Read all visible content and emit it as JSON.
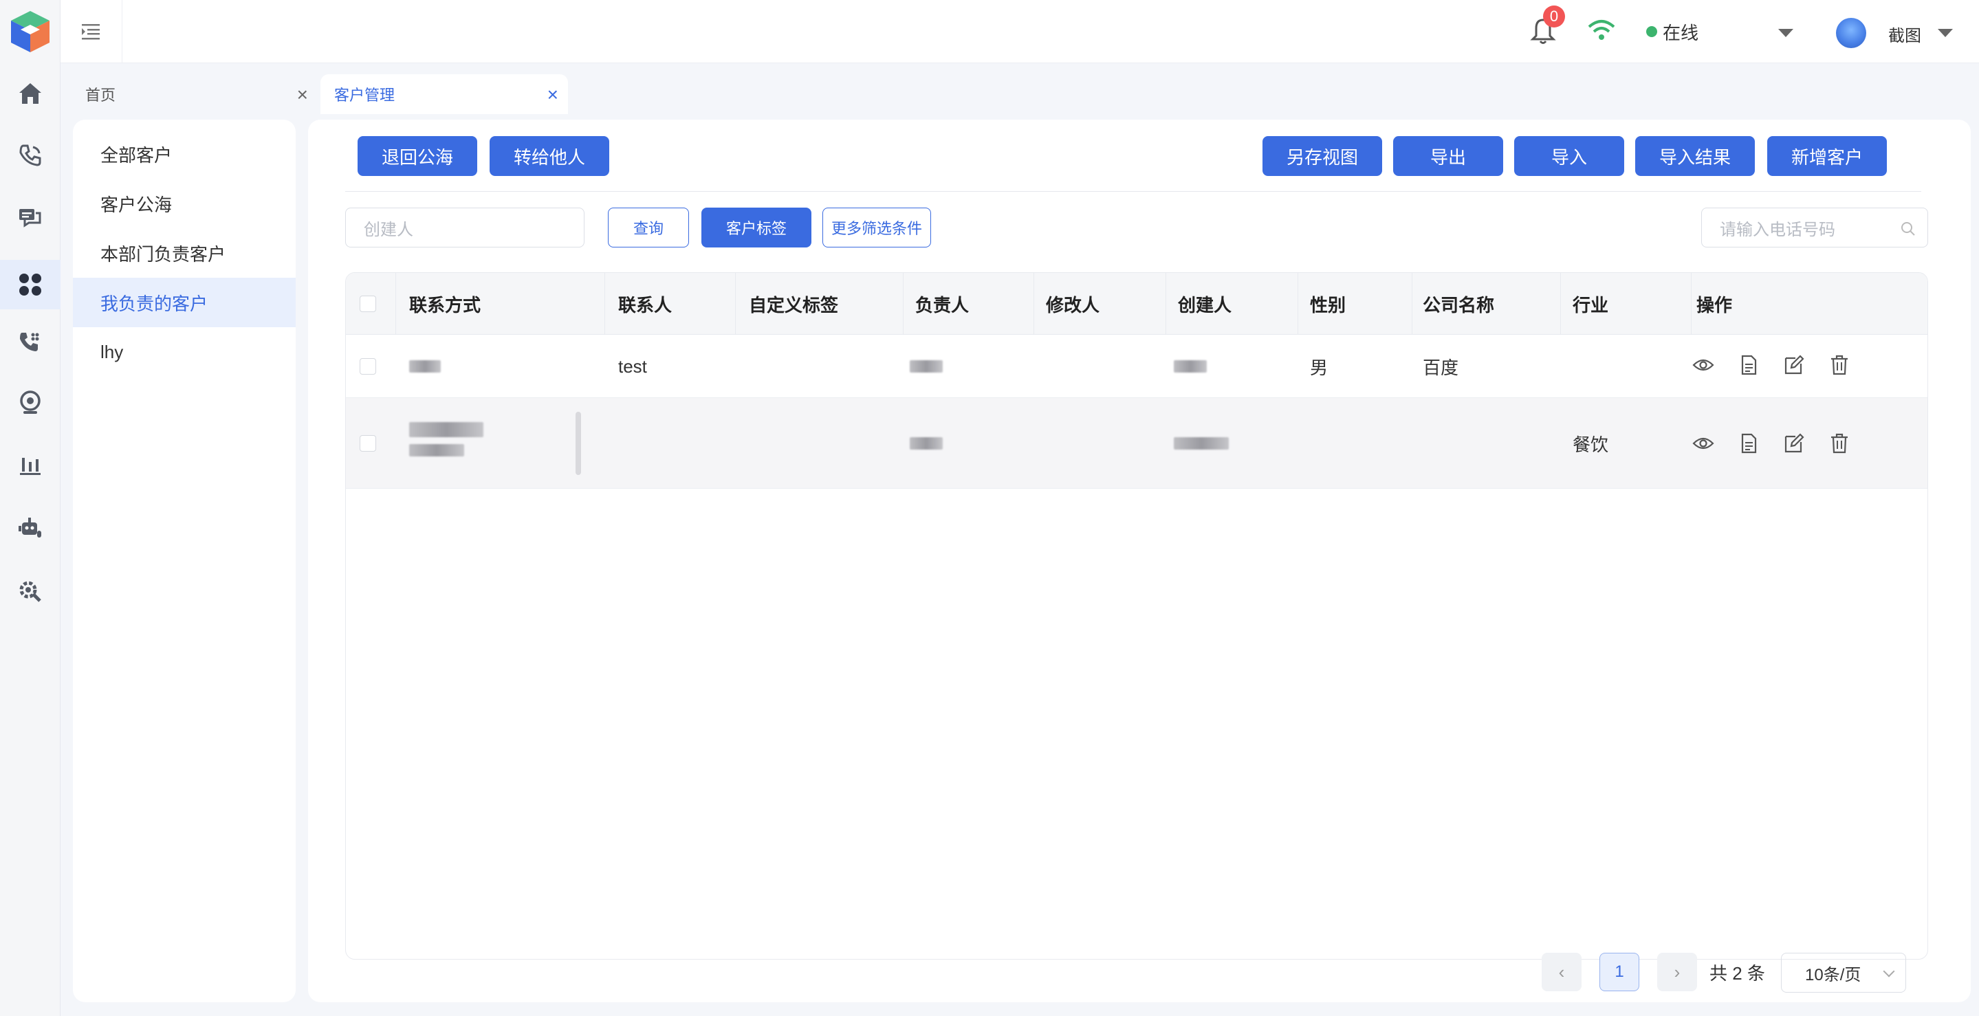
{
  "header": {
    "notification_count": "0",
    "status_label": "在线",
    "status_color": "#3cb46e",
    "user_name": "截图"
  },
  "rail_icons": [
    "home-icon",
    "phone-icon",
    "chat-icon",
    "apps-icon",
    "call-log-icon",
    "webcam-icon",
    "chart-icon",
    "robot-icon",
    "settings-icon"
  ],
  "tabs": [
    {
      "label": "首页",
      "active": false
    },
    {
      "label": "客户管理",
      "active": true
    }
  ],
  "subnav": {
    "items": [
      {
        "label": "全部客户"
      },
      {
        "label": "客户公海"
      },
      {
        "label": "本部门负责客户"
      },
      {
        "label": "我负责的客户"
      },
      {
        "label": "lhy"
      }
    ],
    "active_index": 3
  },
  "toolbar": {
    "return_pool": "退回公海",
    "transfer": "转给他人",
    "save_view": "另存视图",
    "export": "导出",
    "import": "导入",
    "import_result": "导入结果",
    "add_customer": "新增客户"
  },
  "filters": {
    "creator_placeholder": "创建人",
    "query": "查询",
    "customer_tags": "客户标签",
    "more_filters": "更多筛选条件",
    "phone_placeholder": "请输入电话号码"
  },
  "table": {
    "columns": [
      "联系方式",
      "联系人",
      "自定义标签",
      "负责人",
      "修改人",
      "创建人",
      "性别",
      "公司名称",
      "行业",
      "操作"
    ],
    "rows": [
      {
        "contact_name": "test",
        "gender": "男",
        "company": "百度",
        "industry": ""
      },
      {
        "contact_name": "",
        "gender": "",
        "company": "",
        "industry": "餐饮"
      }
    ]
  },
  "pagination": {
    "current_page": "1",
    "total": "共 2 条",
    "page_size": "10条/页"
  },
  "colors": {
    "primary": "#3a6be0",
    "badge": "#f25555",
    "online": "#3cb46e"
  }
}
